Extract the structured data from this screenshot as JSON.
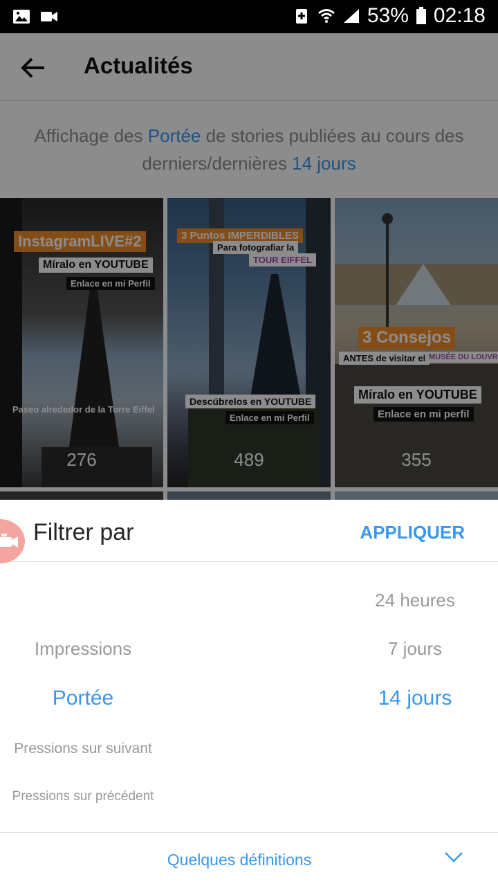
{
  "status_bar": {
    "battery": "53%",
    "time": "02:18",
    "icons": [
      "image-icon",
      "video-icon",
      "battery-saver-icon",
      "wifi-icon",
      "signal-icon",
      "battery-icon"
    ]
  },
  "appbar": {
    "title": "Actualités"
  },
  "description": {
    "part1": "Affichage des ",
    "metric": "Portée",
    "part2": " de stories publiées au cours des derniers/dernières ",
    "period": "14 jours"
  },
  "stories": [
    {
      "count": "276",
      "chips": [
        "InstagramLIVE#2",
        "Míralo en YOUTUBE",
        "Enlace en mi Perfil"
      ],
      "caption": "Paseo alrededor de la Torre Eiffel"
    },
    {
      "count": "489",
      "chips": [
        "3 Puntos IMPERDIBLES",
        "Para fotografiar la",
        "TOUR EIFFEL",
        "Descúbrelos en YOUTUBE",
        "Enlace en mi Perfil"
      ]
    },
    {
      "count": "355",
      "chips": [
        "3 Consejos",
        "ANTES de visitar el",
        "MUSÉE DU LOUVRE",
        "Míralo en YOUTUBE",
        "Enlace en mi perfil"
      ]
    }
  ],
  "sheet": {
    "title": "Filtrer par",
    "apply": "APPLIQUER",
    "metrics": [
      "Impressions",
      "Portée",
      "Pressions sur suivant",
      "Pressions sur précédent"
    ],
    "periods": [
      "24 heures",
      "7 jours",
      "14 jours"
    ],
    "footer": "Quelques définitions"
  },
  "colors": {
    "accent": "#3897f0",
    "fab": "#f5a5a0"
  }
}
